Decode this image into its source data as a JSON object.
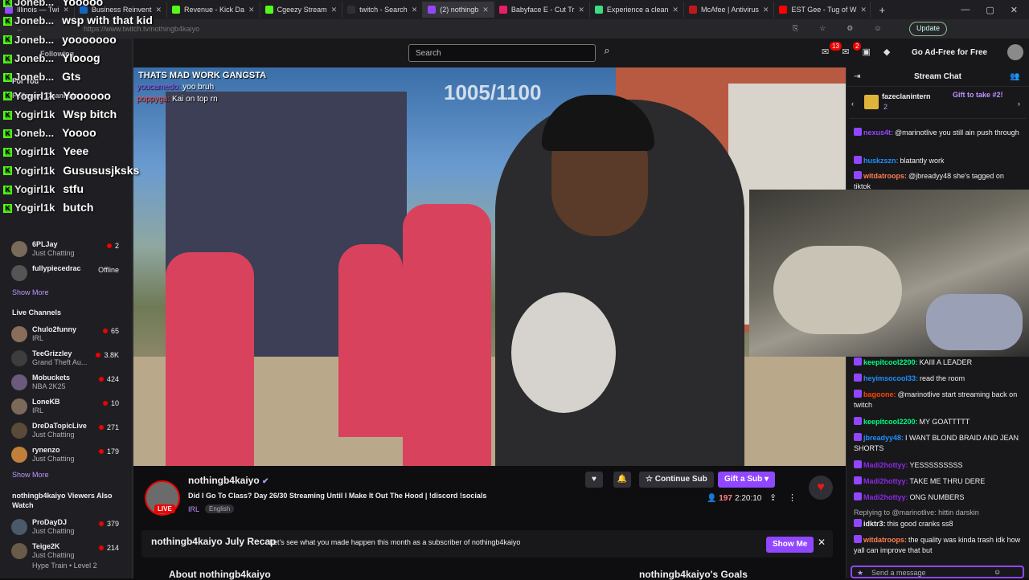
{
  "browser": {
    "tabs": [
      {
        "label": "Illinois — Twi",
        "color": "#9147ff"
      },
      {
        "label": "Business Reinvent",
        "color": "#1565c0"
      },
      {
        "label": "Revenue - Kick Da",
        "color": "#53fc18"
      },
      {
        "label": "Cgeezy Stream",
        "color": "#53fc18"
      },
      {
        "label": "twitch - Search",
        "color": "#2f2f35"
      },
      {
        "label": "(2) nothingb",
        "color": "#9147ff"
      },
      {
        "label": "Babyface E - Cut Tr",
        "color": "#e91e63"
      },
      {
        "label": "Experience a clean",
        "color": "#3ddc84"
      },
      {
        "label": "McAfee | Antivirus",
        "color": "#c01818"
      },
      {
        "label": "EST Gee - Tug of W",
        "color": "#ff0000"
      }
    ],
    "url": "https://www.twitch.tv/nothingb4kaiyo",
    "update_label": "Update"
  },
  "topnav": {
    "search_placeholder": "Search",
    "notif_count": "13",
    "inbox_count": "2",
    "adfree_label": "Go Ad-Free for Free"
  },
  "overlay_chat": [
    {
      "user": "Joneb...",
      "msg": "Yooooo"
    },
    {
      "user": "Joneb...",
      "msg": "wsp with that kid"
    },
    {
      "user": "Joneb...",
      "msg": "yooooooo"
    },
    {
      "user": "Joneb...",
      "msg": "Ylooog"
    },
    {
      "user": "Joneb...",
      "msg": "Gts"
    },
    {
      "user": "Yogirl1k",
      "msg": "Yoooooo"
    },
    {
      "user": "Yogirl1k",
      "msg": "Wsp bitch"
    },
    {
      "user": "Joneb...",
      "msg": "Yoooo"
    },
    {
      "user": "Yogirl1k",
      "msg": "Yeee"
    },
    {
      "user": "Yogirl1k",
      "msg": "Gusususjksks"
    },
    {
      "user": "Yogirl1k",
      "msg": "stfu"
    },
    {
      "user": "Yogirl1k",
      "msg": "butch"
    }
  ],
  "sidebar": {
    "following_label": "Following",
    "for_you_label": "For You",
    "followed_label": "Followed Channels",
    "followed": [
      {
        "name": "6PLJay",
        "game": "Just Chatting",
        "viewers": "2",
        "color": "#7a6a5a"
      },
      {
        "name": "fullypiecedrac",
        "game": "",
        "viewers": "Offline",
        "color": "#555"
      }
    ],
    "show_more": "Show More",
    "live_label": "Live Channels",
    "live": [
      {
        "name": "Chulo2funny",
        "game": "IRL",
        "viewers": "65",
        "color": "#8a6d5b"
      },
      {
        "name": "TeeGrizzley",
        "game": "Grand Theft Au...",
        "viewers": "3.8K",
        "color": "#3d3d3d"
      },
      {
        "name": "Mobuckets",
        "game": "NBA 2K25",
        "viewers": "424",
        "color": "#6b5a7b"
      },
      {
        "name": "LoneKB",
        "game": "IRL",
        "viewers": "10",
        "color": "#7b6a5a"
      },
      {
        "name": "DreDaTopicLive",
        "game": "Just Chatting",
        "viewers": "271",
        "color": "#5a4a3a"
      },
      {
        "name": "rynenzo",
        "game": "Just Chatting",
        "viewers": "179",
        "color": "#c0803a"
      }
    ],
    "show_more_2": "Show More",
    "also_watch_label": "nothingb4kaiyo Viewers Also Watch",
    "also_watch": [
      {
        "name": "ProDayDJ",
        "game": "Just Chatting",
        "viewers": "379",
        "color": "#4a5a6a"
      },
      {
        "name": "Teige2K",
        "game": "Just Chatting",
        "viewers": "214",
        "color": "#6a5a4a"
      }
    ],
    "hype_train": "Hype Train • Level 2"
  },
  "video": {
    "overlay_title": "THATS MAD WORK GANGSTA",
    "overlay_line1_user": "youcamedo:",
    "overlay_line1_msg": "yoo bruh",
    "overlay_line2_user": "poppyga:",
    "overlay_line2_msg": "Kai on top rn",
    "counter": "1005/1100"
  },
  "channel": {
    "name": "nothingb4kaiyo",
    "title": "Did I Go To Class? Day 26/30 Streaming Until I Make It Out The Hood | !discord !socials",
    "category": "IRL",
    "tag": "English",
    "live_label": "LIVE",
    "viewers": "197",
    "uptime": "2:20:10",
    "continue_sub": "Continue Sub",
    "gift_sub": "Gift a Sub"
  },
  "recap": {
    "title": "nothingb4kaiyo July Recap",
    "subtitle": "Let's see what you made happen this month as a subscriber of nothingb4kaiyo",
    "button": "Show Me"
  },
  "about_label": "About nothingb4kaiyo",
  "goals_label": "nothingb4kaiyo's Goals",
  "chat": {
    "title": "Stream Chat",
    "gift_user": "fazeclanintern",
    "gift_count": "2",
    "gift_take": "Gift to take #2!",
    "messages_top": [
      {
        "user": "nexus4t:",
        "msg": "@marinotlive you still ain push through",
        "color": "#9147ff"
      },
      {
        "user": "huskzszn:",
        "msg": "blatantly work",
        "color": "#1e90ff"
      },
      {
        "user": "witdatroops:",
        "msg": "@jbreadyy48 she's tagged on tiktok",
        "color": "#ff7f50"
      }
    ],
    "messages_bottom": [
      {
        "user": "keepitcool2200:",
        "msg": "KAIII A LEADER",
        "color": "#00ff7f"
      },
      {
        "user": "heyimsocool33:",
        "msg": "read the room",
        "color": "#1e90ff"
      },
      {
        "user": "bagoone:",
        "msg": "@marinotlive start streaming back on twitch",
        "color": "#ff4500"
      },
      {
        "user": "keepitcool2200:",
        "msg": "MY GOATTTTT",
        "color": "#00ff7f"
      },
      {
        "user": "jbreadyy48:",
        "msg": "I WANT BLOND BRAID AND JEAN SHORTS",
        "color": "#1e90ff"
      },
      {
        "user": "Madi2hottyy:",
        "msg": "YESSSSSSSSS",
        "color": "#8a2be2"
      },
      {
        "user": "Madi2hottyy:",
        "msg": "TAKE ME THRU DERE",
        "color": "#8a2be2"
      },
      {
        "user": "Madi2hottyy:",
        "msg": "ONG NUMBERS",
        "color": "#8a2be2"
      },
      {
        "user": "",
        "msg": "Replying to @marinotlive: hittin darskin",
        "color": "#adadb8"
      },
      {
        "user": "idktr3:",
        "msg": "this good cranks ss8",
        "color": "#efeff1"
      },
      {
        "user": "witdatroops:",
        "msg": "the quality was kinda trash idk how yall can improve that but",
        "color": "#ff7f50"
      }
    ],
    "input_placeholder": "Send a message"
  }
}
